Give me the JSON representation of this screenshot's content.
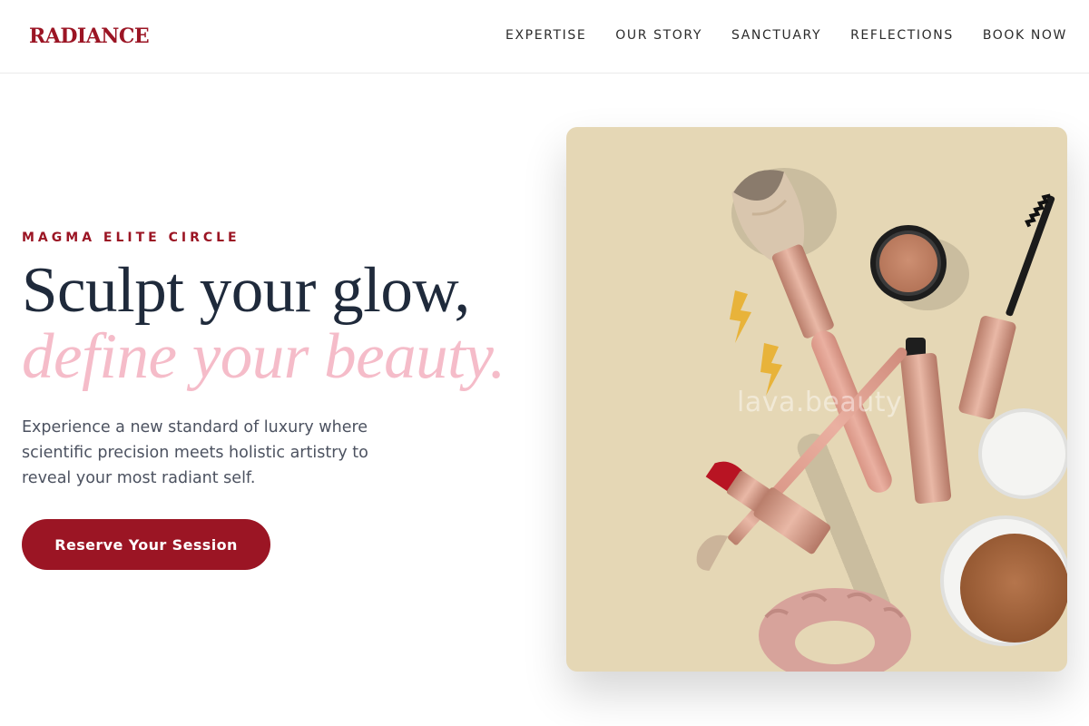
{
  "brand": {
    "logo": "RADIANCE"
  },
  "nav": {
    "items": [
      "EXPERTISE",
      "OUR STORY",
      "SANCTUARY",
      "REFLECTIONS",
      "BOOK NOW"
    ]
  },
  "hero": {
    "eyebrow": "MAGMA ELITE CIRCLE",
    "headline_line1": "Sculpt your glow,",
    "headline_line2": "define your beauty.",
    "lede": "Experience a new standard of luxury where scientific precision meets holistic artistry to reveal your most radiant self.",
    "cta_label": "Reserve Your Session",
    "image_watermark": "lava.beauty"
  },
  "colors": {
    "brand": "#9b1524",
    "headline": "#1f2a3b",
    "accent_pink": "#f5bcc9",
    "image_background": "#e5d7b5"
  }
}
